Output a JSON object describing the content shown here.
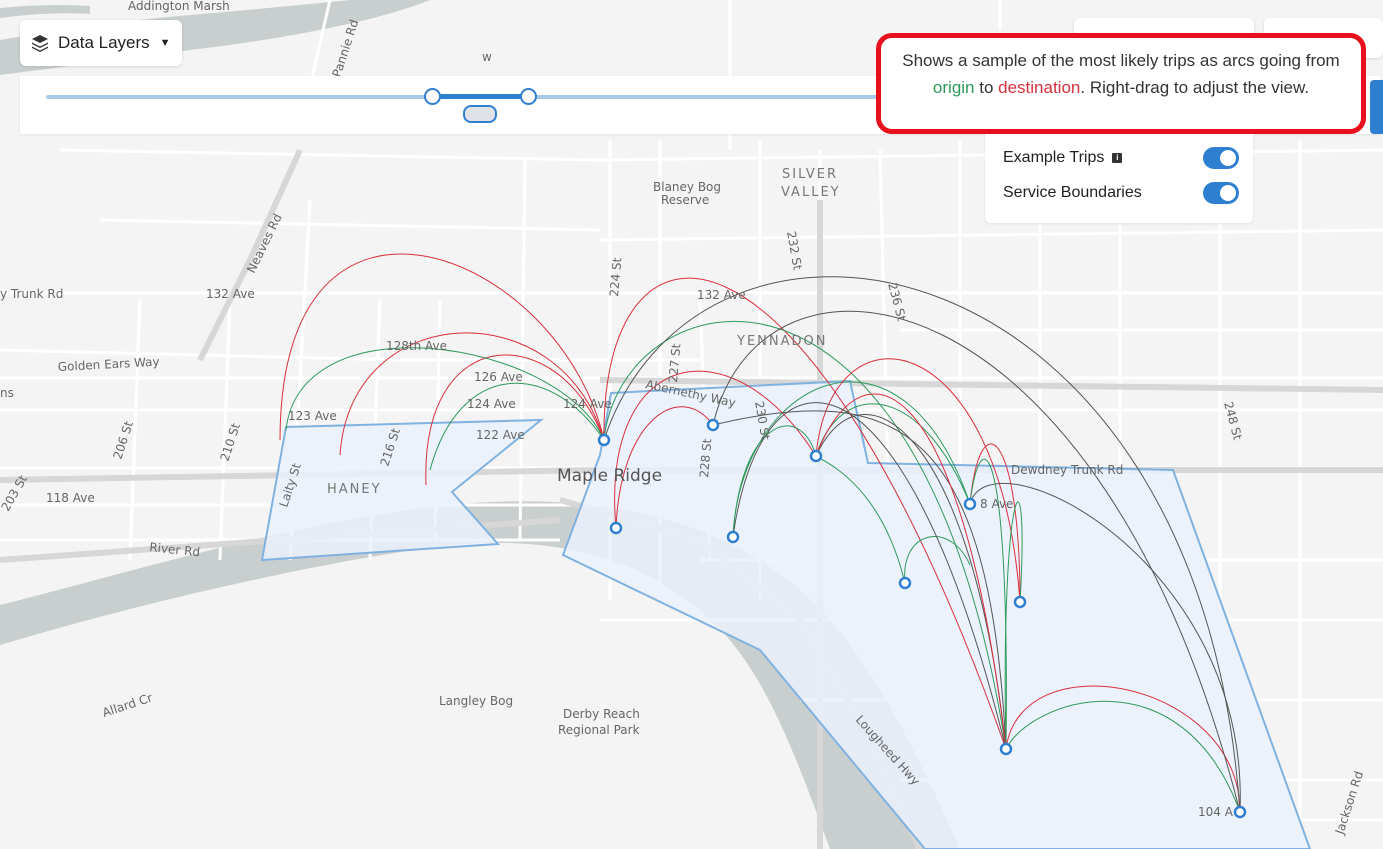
{
  "layers_button": {
    "label": "Data Layers",
    "icon": "layers-icon"
  },
  "tooltip": {
    "text_before": "Shows a sample of the most likely trips as arcs going from ",
    "origin": "origin",
    "middle": " to ",
    "destination": "destination",
    "text_after": ". Right-drag to adjust the view.",
    "origin_color": "#2e9a5a",
    "destination_color": "#d8303c"
  },
  "layer_panel": {
    "items": [
      {
        "label": "Example Trips",
        "info_icon": "info-icon",
        "enabled": true
      },
      {
        "label": "Service Boundaries",
        "enabled": true
      }
    ]
  },
  "map_labels": {
    "places": {
      "addington": "Addington Marsh",
      "blaney1": "Blaney Bog",
      "blaney2": "Reserve",
      "silver1": "SILVER",
      "silver2": "VALLEY",
      "yennadon": "YENNADON",
      "haney": "HANEY",
      "maple": "Maple Ridge",
      "langley": "Langley Bog",
      "derby1": "Derby Reach",
      "derby2": "Regional Park",
      "w": "w"
    },
    "roads": {
      "trunk": "y Trunk Rd",
      "ave132a": "132 Ave",
      "ave132b": "132 Ave",
      "golden": "Golden Ears Way",
      "ave128": "128th Ave",
      "ave126": "126 Ave",
      "ave124a": "124 Ave",
      "ave124b": "124 Ave",
      "ave123": "123 Ave",
      "ave122": "122 Ave",
      "ave118": "118 Ave",
      "river": "River Rd",
      "allard": "Allard Cr",
      "abernethy": "Abernethy Way",
      "dewdney": "Dewdney Trunk Rd",
      "ave8": "8 Ave",
      "ave104": "104 A",
      "lougheed": "Lougheed Hwy",
      "jackson": "Jackson Rd",
      "neaves": "Neaves Rd",
      "st224": "224 St",
      "st227": "227 St",
      "st228": "228 St",
      "st230": "230 St",
      "st232": "232 St",
      "st236": "236 St",
      "st248": "248 St",
      "st206": "206 St",
      "st210": "210 St",
      "st216": "216 St",
      "laity": "Laity St",
      "st203": "203 St",
      "pannie": "Pannie Rd",
      "ns": "ns"
    }
  },
  "colors": {
    "boundary": "#7fb2e0",
    "boundary_fill": "#eaf1fb",
    "stop": "#2f7fd1",
    "river": "#c9cfcf"
  }
}
